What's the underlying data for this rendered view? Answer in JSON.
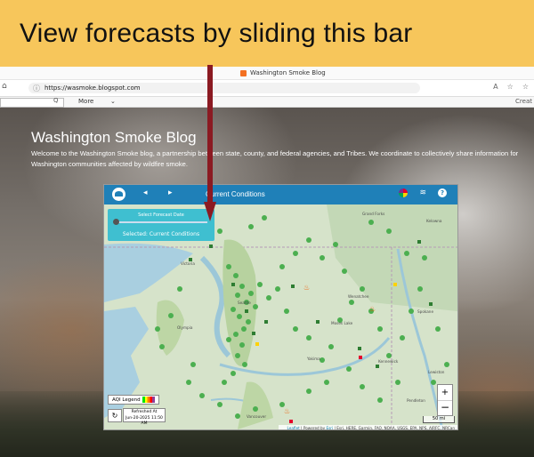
{
  "banner": {
    "title": "View forecasts by sliding this bar"
  },
  "browser": {
    "tab_title": "Washington Smoke Blog",
    "url": "https://wasmoke.blogspot.com",
    "search_label": "Q",
    "more_label": "More",
    "create_label": "Creat"
  },
  "blog": {
    "title": "Washington Smoke Blog",
    "description": "Welcome to the Washington Smoke blog, a partnership between state, county, and federal agencies, and Tribes. We coordinate to collectively share information for Washington communities affected by wildfire smoke."
  },
  "map": {
    "header_title": "Current Conditions",
    "slider_label": "Select Forecast Date",
    "selected_prefix": "Selected: ",
    "selected_value": "Current Conditions",
    "aqi_legend": "AQI Legend",
    "refreshed_label": "Refreshed At",
    "refreshed_time": "Jun-20-2025 11:50 AM",
    "scale_label": "50 mi",
    "zoom_in": "+",
    "zoom_out": "−",
    "attribution_leaflet": "Leaflet",
    "attribution_powered": " | Powered by ",
    "attribution_esri": "Esri",
    "attribution_rest": " | Esri, HERE, Garmin, FAO, NOAA, USGS, EPA, NPS, AIRFC, NRCan",
    "labels": [
      {
        "text": "Grand Forks"
      },
      {
        "text": "Kelowna"
      },
      {
        "text": "Wenatchee"
      },
      {
        "text": "Spokane"
      },
      {
        "text": "Moses Lake"
      },
      {
        "text": "Yakima"
      },
      {
        "text": "Kennewick"
      },
      {
        "text": "Pendleton"
      },
      {
        "text": "Lewiston"
      },
      {
        "text": "Vancouver"
      },
      {
        "text": "Olympia"
      },
      {
        "text": "Seattle"
      },
      {
        "text": "Victoria"
      }
    ]
  },
  "colors": {
    "banner": "#f7c65b",
    "header": "#1f80b8",
    "slider_panel": "#3fbfd0",
    "arrow": "#8b1a22",
    "marker": "#4caf50"
  }
}
